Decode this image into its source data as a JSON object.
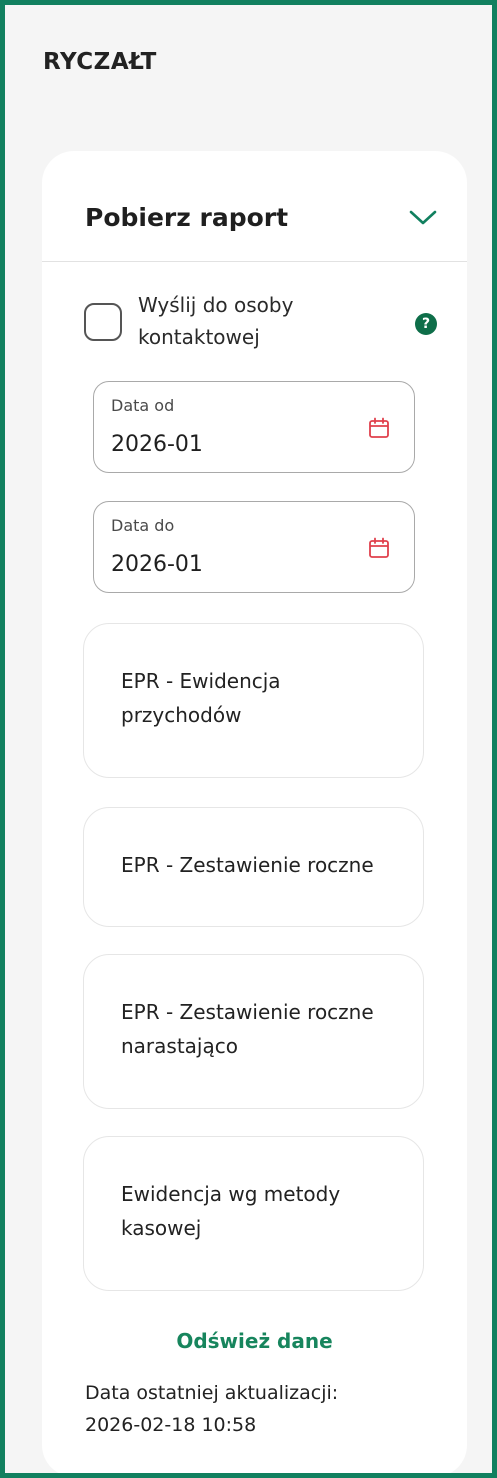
{
  "section": {
    "title": "RYCZAŁT"
  },
  "card": {
    "title": "Pobierz raport",
    "chevron_icon": "chevron-down-icon"
  },
  "send_contact": {
    "label": "Wyślij do osoby kontaktowej",
    "checked": false,
    "help_icon": "question-icon",
    "help_glyph": "?"
  },
  "date_from": {
    "label": "Data od",
    "value": "2026-01",
    "icon": "calendar-icon"
  },
  "date_to": {
    "label": "Data do",
    "value": "2026-01",
    "icon": "calendar-icon"
  },
  "reports": [
    {
      "label": "EPR - Ewidencja przychodów"
    },
    {
      "label": "EPR - Zestawienie roczne"
    },
    {
      "label": "EPR - Zestawienie roczne narastająco"
    },
    {
      "label": "Ewidencja wg metody kasowej"
    }
  ],
  "refresh": {
    "label": "Odśwież dane"
  },
  "last_update": {
    "label": "Data ostatniej aktualizacji:",
    "value": "2026-02-18 10:58"
  },
  "colors": {
    "brand_green": "#11805f",
    "link_green": "#17855d",
    "help_green": "#0e6e49",
    "calendar_red": "#e0404c"
  }
}
